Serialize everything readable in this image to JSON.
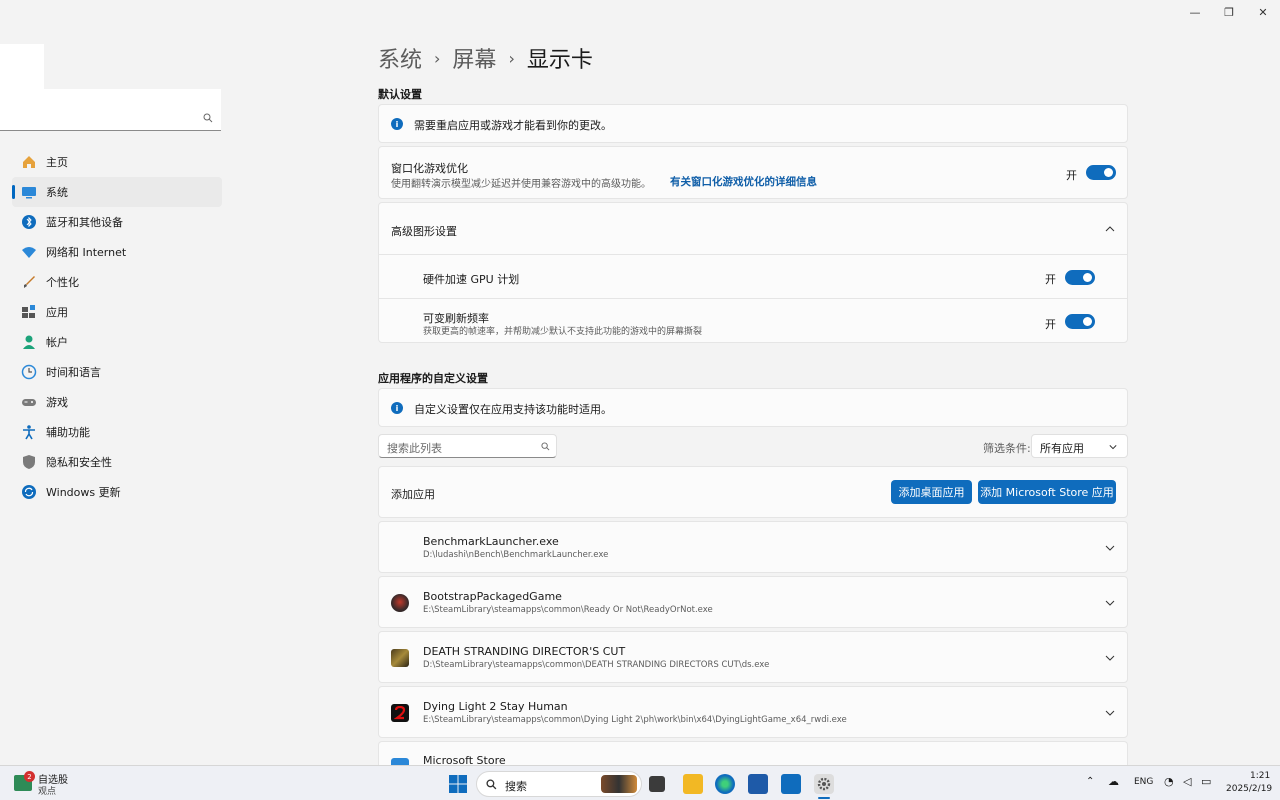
{
  "window": {
    "minimize": "—",
    "restore": "❐",
    "close": "✕"
  },
  "sidebar": {
    "items": [
      {
        "label": "主页",
        "icon": "home-icon"
      },
      {
        "label": "系统",
        "icon": "system-icon",
        "active": true
      },
      {
        "label": "蓝牙和其他设备",
        "icon": "bluetooth-icon"
      },
      {
        "label": "网络和 Internet",
        "icon": "network-icon"
      },
      {
        "label": "个性化",
        "icon": "personalization-icon"
      },
      {
        "label": "应用",
        "icon": "apps-icon"
      },
      {
        "label": "帐户",
        "icon": "account-icon"
      },
      {
        "label": "时间和语言",
        "icon": "time-language-icon"
      },
      {
        "label": "游戏",
        "icon": "gaming-icon"
      },
      {
        "label": "辅助功能",
        "icon": "accessibility-icon"
      },
      {
        "label": "隐私和安全性",
        "icon": "privacy-icon"
      },
      {
        "label": "Windows 更新",
        "icon": "update-icon"
      }
    ]
  },
  "breadcrumb": {
    "level1": "系统",
    "level2": "屏幕",
    "current": "显示卡",
    "separator": "›"
  },
  "defaults": {
    "heading": "默认设置",
    "notice": "需要重启应用或游戏才能看到你的更改。",
    "windowed": {
      "title": "窗口化游戏优化",
      "desc": "使用翻转演示模型减少延迟并使用兼容游戏中的高级功能。",
      "link": "有关窗口化游戏优化的详细信息",
      "state": "开"
    },
    "advanced": {
      "title": "高级图形设置",
      "gpu": {
        "title": "硬件加速 GPU 计划",
        "state": "开"
      },
      "vrr": {
        "title": "可变刷新频率",
        "desc": "获取更高的帧速率，并帮助减少默认不支持此功能的游戏中的屏幕撕裂",
        "state": "开"
      }
    }
  },
  "custom": {
    "heading": "应用程序的自定义设置",
    "notice": "自定义设置仅在应用支持该功能时适用。",
    "search_placeholder": "搜索此列表",
    "filter_label": "筛选条件:",
    "filter_value": "所有应用",
    "add_label": "添加应用",
    "add_desktop": "添加桌面应用",
    "add_store": "添加 Microsoft Store 应用",
    "apps": [
      {
        "name": "BenchmarkLauncher.exe",
        "path": "D:\\ludashi\\nBench\\BenchmarkLauncher.exe"
      },
      {
        "name": "BootstrapPackagedGame",
        "path": "E:\\SteamLibrary\\steamapps\\common\\Ready Or Not\\ReadyOrNot.exe"
      },
      {
        "name": "DEATH STRANDING DIRECTOR'S CUT",
        "path": "D:\\SteamLibrary\\steamapps\\common\\DEATH STRANDING DIRECTORS CUT\\ds.exe"
      },
      {
        "name": "Dying Light 2 Stay Human",
        "path": "E:\\SteamLibrary\\steamapps\\common\\Dying Light 2\\ph\\work\\bin\\x64\\DyingLightGame_x64_rwdi.exe"
      },
      {
        "name": "Microsoft Store",
        "path": ""
      }
    ]
  },
  "taskbar": {
    "widget_title": "自选股",
    "widget_sub": "观点",
    "widget_badge": "2",
    "search": "搜索",
    "lang": "ENG",
    "time": "1:21",
    "date": "2025/2/19"
  },
  "colors": {
    "accent": "#0f6cbd",
    "background": "#f3f3f3",
    "card": "#fbfbfb"
  }
}
